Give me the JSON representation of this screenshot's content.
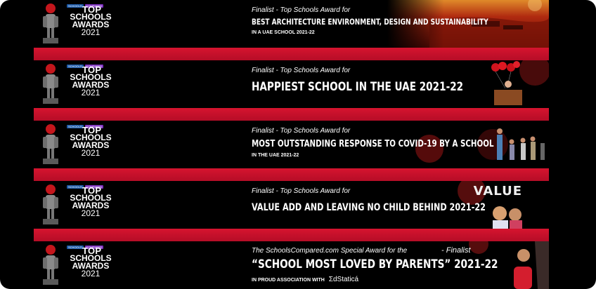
{
  "logo": {
    "badge1": "SCHOOLS",
    "badge2": "COMPARED",
    "line1": "TOP",
    "line2": "SCHOOLS",
    "line3": "AWARDS",
    "line4": "2021"
  },
  "banners": [
    {
      "kicker": "Finalist - Top Schools Award for",
      "title": "BEST ARCHITECTURE ENVIRONMENT, DESIGN AND SUSTAINABILITY",
      "sub": "IN A UAE SCHOOL 2021-22"
    },
    {
      "kicker": "Finalist - Top Schools Award for",
      "title": "HAPPIEST SCHOOL IN THE UAE 2021-22",
      "sub": ""
    },
    {
      "kicker": "Finalist - Top Schools Award for",
      "title": "MOST OUTSTANDING RESPONSE TO COVID-19 BY A SCHOOL",
      "sub": "IN THE UAE 2021-22"
    },
    {
      "kicker": "Finalist - Top Schools Award for",
      "title": "VALUE ADD AND LEAVING NO CHILD BEHIND 2021-22",
      "sub": "",
      "side_word": "VALUE"
    },
    {
      "kicker": "The SchoolsCompared.com Special Award for the",
      "kicker_right": "- Finalist",
      "title": "“SCHOOL MOST LOVED BY PARENTS” 2021-22",
      "sub": "IN PROUD ASSOCIATION WITH",
      "partner": "ΣdStaticá"
    }
  ],
  "colors": {
    "background": "#000000",
    "bar_red": "#c8102e",
    "text": "#ffffff"
  }
}
